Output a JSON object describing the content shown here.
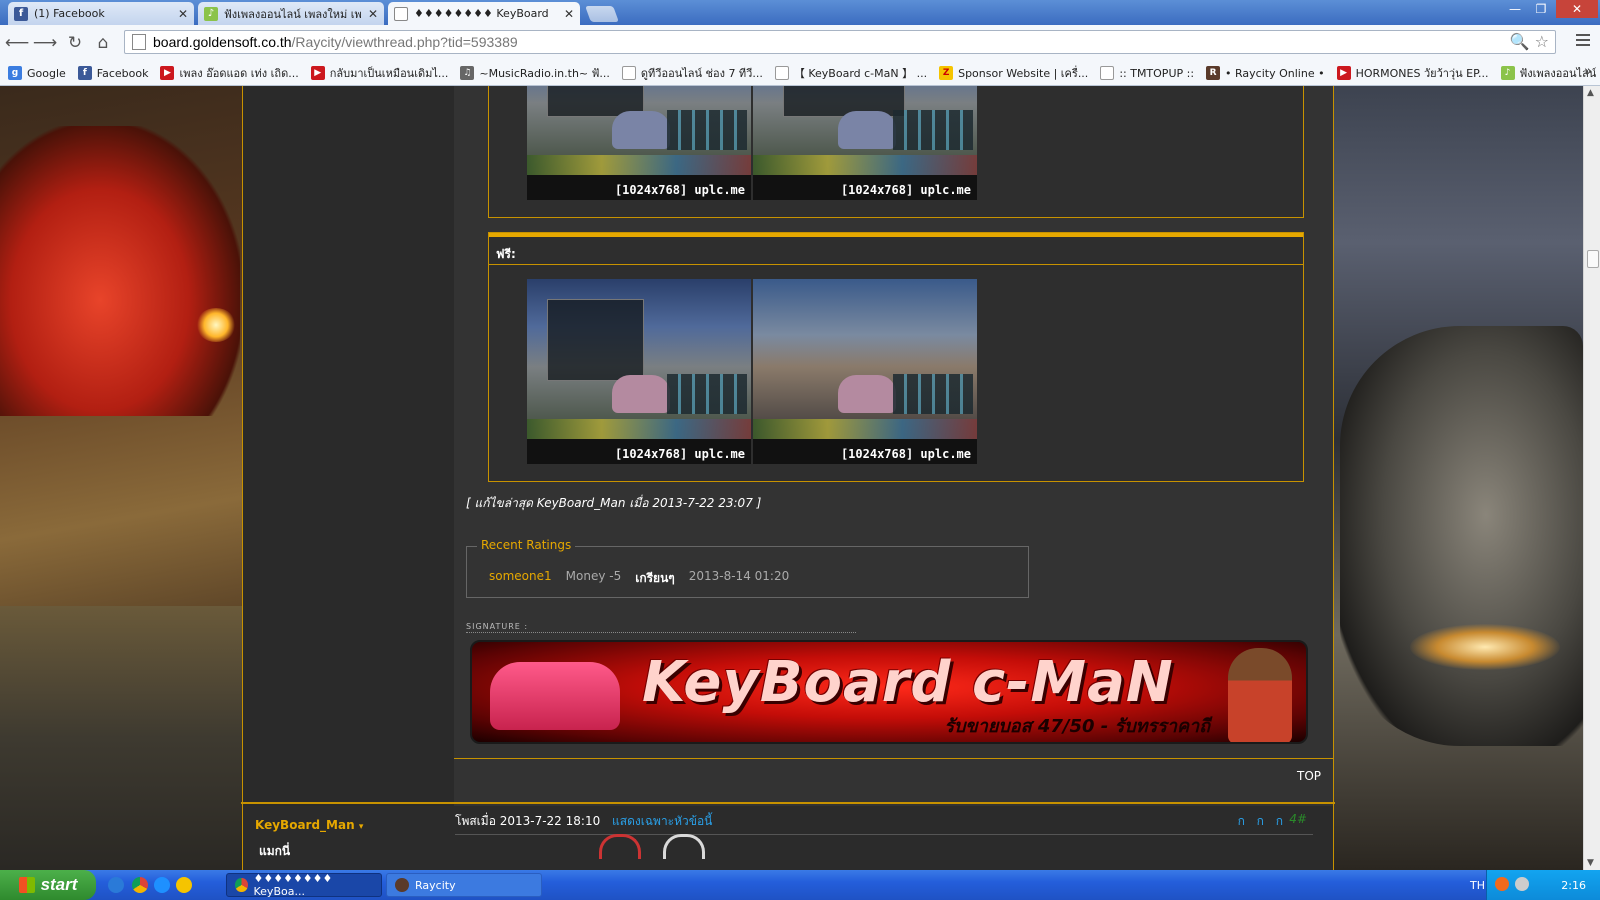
{
  "browser": {
    "tabs": [
      {
        "title": "(1) Facebook",
        "icon": "facebook-icon",
        "color": "#3b5998"
      },
      {
        "title": "ฟังเพลงออนไลน์ เพลงใหม่ เพ",
        "icon": "music-site-icon",
        "color": "#8bc34a"
      },
      {
        "title": "♦♦♦♦♦♦♦♦ KeyBoard",
        "icon": "page-icon",
        "color": "#ffffff"
      }
    ],
    "url_host": "board.goldensoft.co.th",
    "url_path": "/Raycity/viewthread.php?tid=593389",
    "bookmarks": [
      {
        "label": "Google",
        "icon": "google-icon",
        "color": "#3b7de0"
      },
      {
        "label": "Facebook",
        "icon": "facebook-icon",
        "color": "#3b5998"
      },
      {
        "label": "เพลง อ๊อดแอด เท่ง เถิด...",
        "icon": "youtube-icon",
        "color": "#cc181e"
      },
      {
        "label": "กลับมาเป็นเหมือนเดิมไ...",
        "icon": "youtube-icon",
        "color": "#cc181e"
      },
      {
        "label": "~MusicRadio.in.th~ ฟั...",
        "icon": "radio-icon",
        "color": "#666666"
      },
      {
        "label": "ดูทีวีออนไลน์ ช่อง 7 ทีวี...",
        "icon": "page-icon",
        "color": "#ffffff"
      },
      {
        "label": "【 KeyBoard c-MaN 】 ...",
        "icon": "page-icon",
        "color": "#ffffff"
      },
      {
        "label": "Sponsor Website | เครื่...",
        "icon": "sponsor-icon",
        "color": "#f5c400"
      },
      {
        "label": ":: TMTOPUP ::",
        "icon": "page-icon",
        "color": "#ffffff"
      },
      {
        "label": "• Raycity Online •",
        "icon": "raycity-icon",
        "color": "#5a3a2a"
      },
      {
        "label": "HORMONES วัยว้าวุ่น EP...",
        "icon": "youtube-icon",
        "color": "#cc181e"
      },
      {
        "label": "ฟังเพลงออนไลน์ เพลงใ...",
        "icon": "music-site-icon",
        "color": "#8bc34a"
      }
    ],
    "more_label": "»"
  },
  "post": {
    "screenshot_caption": "[1024x768] uplc.me",
    "box_heading": "ฟรี:",
    "edit_note": "[ แก้ไขล่าสุด KeyBoard_Man เมื่อ 2013-7-22 23:07 ]",
    "ratings": {
      "legend": "Recent Ratings",
      "user": "someone1",
      "value": "Money -5",
      "comment": "เกรียนๆ",
      "time": "2013-8-14 01:20"
    },
    "signature_label": "SIGNATURE :",
    "banner": {
      "title": "KeyBoard c-MaN",
      "subtitle": "รับขายบอส 47/50 - รับทรราคาถี"
    },
    "top_link": "TOP"
  },
  "next_post": {
    "author": "KeyBoard_Man",
    "author_sub": "แมกนี่",
    "posted": "โพสเมื่อ 2013-7-22 18:10",
    "only_author": "แสดงเฉพาะหัวข้อนี้",
    "font_sizes": "ก ก ก",
    "floor": "4#"
  },
  "taskbar": {
    "start": "start",
    "tasks": [
      {
        "label": "♦♦♦♦♦♦♦♦ KeyBoa...",
        "icon": "chrome-icon"
      },
      {
        "label": "Raycity",
        "icon": "raycity-icon"
      }
    ],
    "lang": "TH",
    "clock": "2:16"
  },
  "colors": {
    "accent": "#e6a800",
    "link_blue": "#2aa0e8",
    "rating_user": "#e6a800"
  }
}
